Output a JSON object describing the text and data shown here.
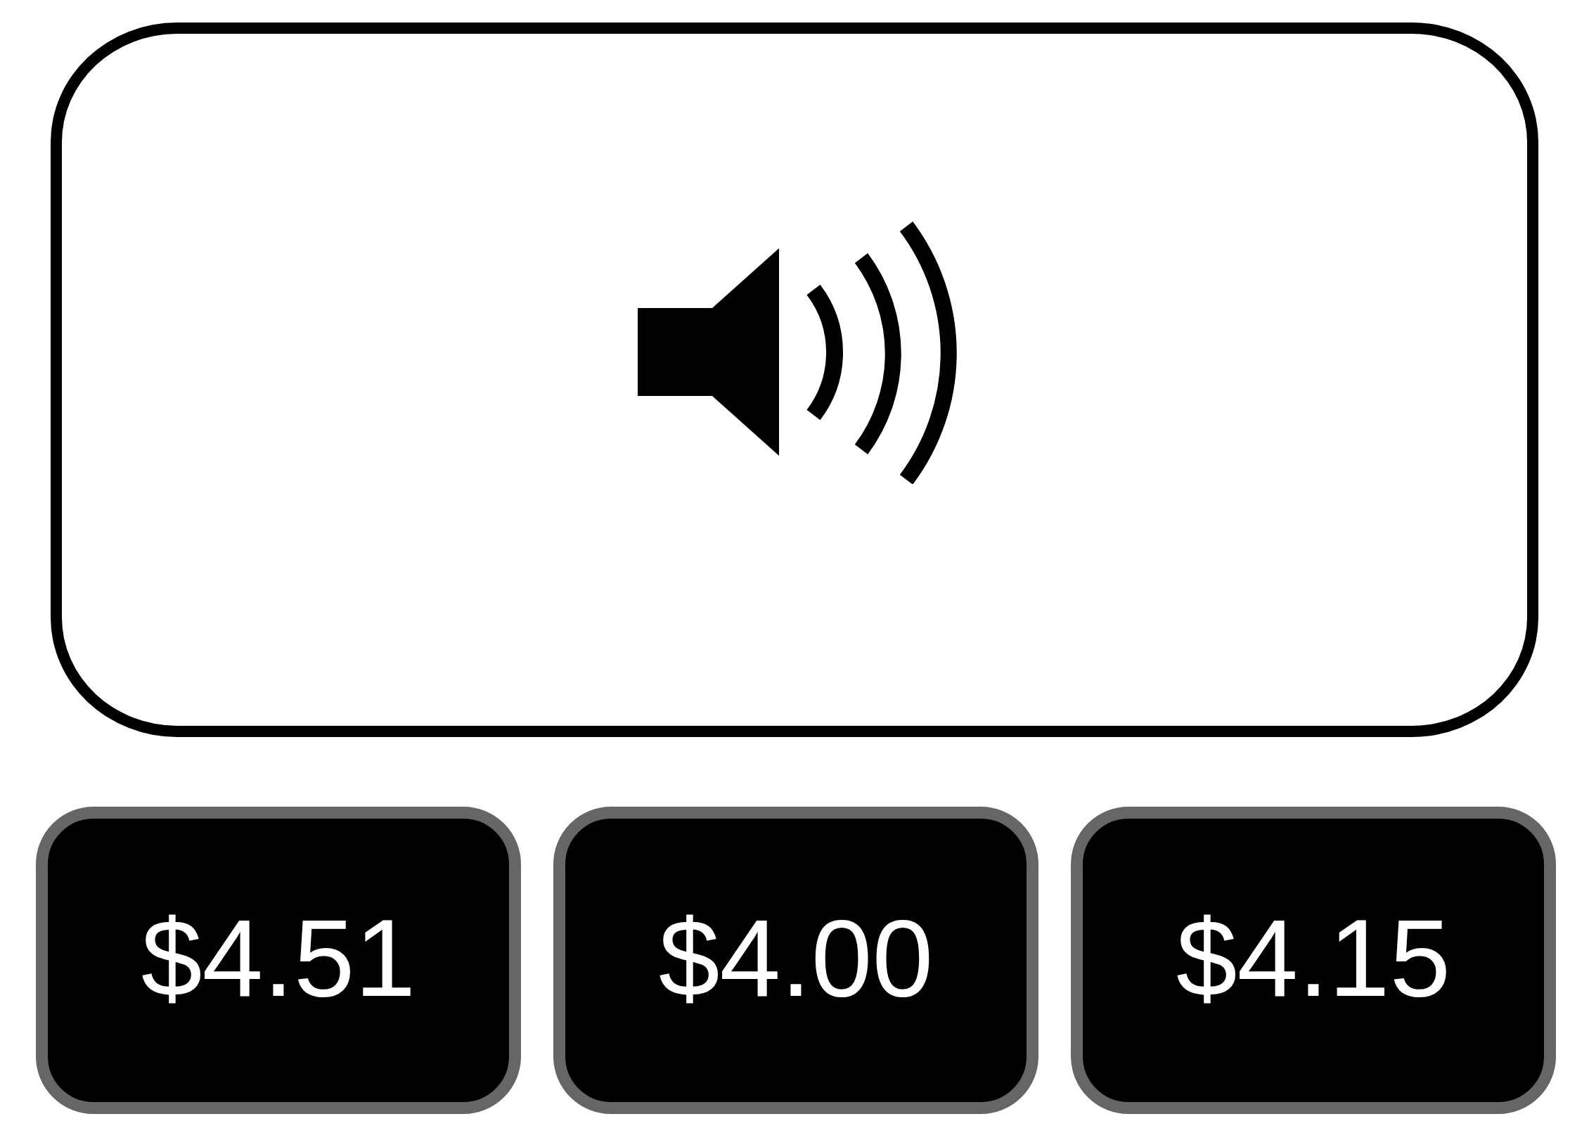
{
  "options": [
    {
      "label": "$4.51"
    },
    {
      "label": "$4.00"
    },
    {
      "label": "$4.15"
    }
  ]
}
